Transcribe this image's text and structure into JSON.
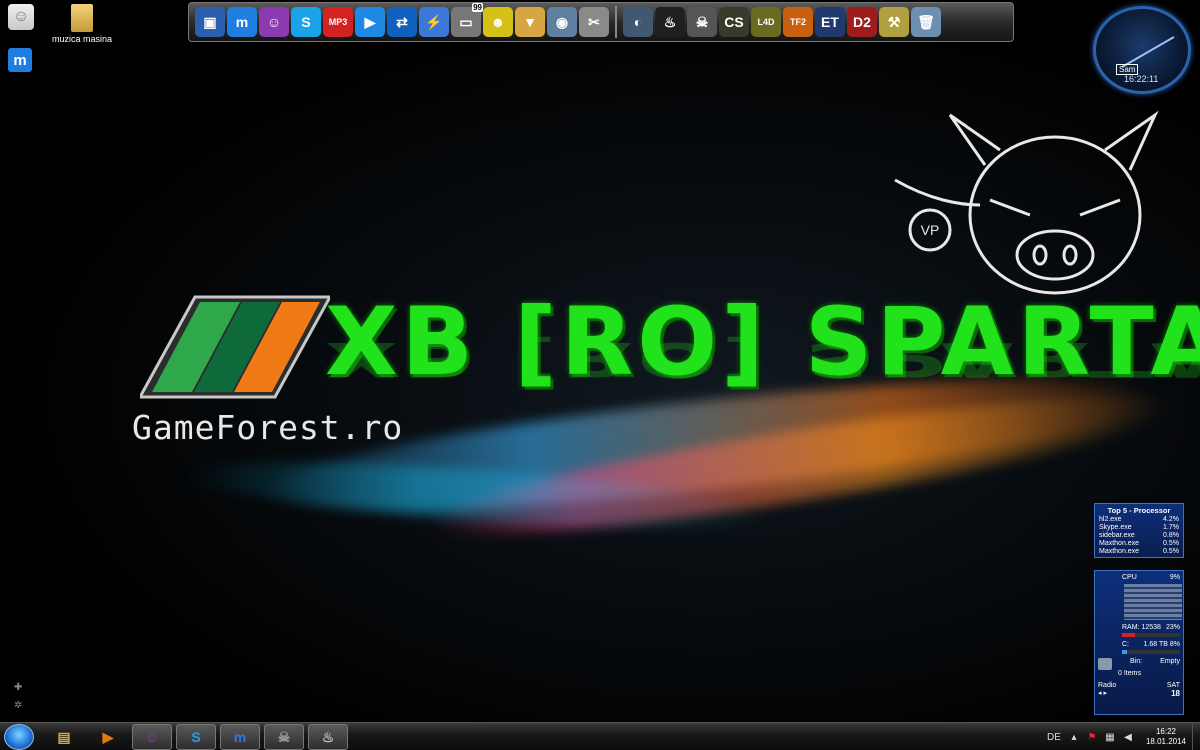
{
  "desktop": {
    "icons": [
      {
        "label": ""
      },
      {
        "label": "muzica masina"
      },
      {
        "label": ""
      }
    ]
  },
  "wallpaper": {
    "headline": "XB [RO] SPARTA",
    "site": "GameForest.ro",
    "pig_badge": "VP"
  },
  "dock": {
    "badge_count": "99",
    "apps": [
      {
        "icon": "computer-icon",
        "glyph": "▣",
        "color": "#2a5fb0"
      },
      {
        "icon": "maxthon-icon",
        "glyph": "m",
        "color": "#1f7ee0"
      },
      {
        "icon": "messenger-icon",
        "glyph": "☺",
        "color": "#8d3ab0"
      },
      {
        "icon": "skype-icon",
        "glyph": "S",
        "color": "#1aa3e8"
      },
      {
        "icon": "mp3-icon",
        "glyph": "MP3",
        "color": "#d32222"
      },
      {
        "icon": "media-player-icon",
        "glyph": "▶",
        "color": "#1e88e5"
      },
      {
        "icon": "teamviewer-icon",
        "glyph": "⇄",
        "color": "#1060c0"
      },
      {
        "icon": "daemon-tools-icon",
        "glyph": "⚡",
        "color": "#3c78d8"
      },
      {
        "icon": "monitor-icon",
        "glyph": "▭",
        "color": "#777"
      },
      {
        "icon": "smiley-icon",
        "glyph": "☻",
        "color": "#d5c018"
      },
      {
        "icon": "downloads-folder-icon",
        "glyph": "▼",
        "color": "#d8a640"
      },
      {
        "icon": "network-icon",
        "glyph": "◉",
        "color": "#5d7fa0"
      },
      {
        "icon": "tools-icon",
        "glyph": "✂",
        "color": "#8a8a8a"
      }
    ],
    "games": [
      {
        "icon": "dota-icon",
        "glyph": "◐",
        "color": "#405870"
      },
      {
        "icon": "steam-icon",
        "glyph": "♨",
        "color": "#202020"
      },
      {
        "icon": "counter-strike-icon",
        "glyph": "☠",
        "color": "#555"
      },
      {
        "icon": "csgo-icon",
        "glyph": "CS",
        "color": "#3a3a2a"
      },
      {
        "icon": "left4dead2-icon",
        "glyph": "L4D",
        "color": "#6a6a20"
      },
      {
        "icon": "team-fortress-icon",
        "glyph": "TF2",
        "color": "#c86010"
      },
      {
        "icon": "euro-truck-icon",
        "glyph": "ET",
        "color": "#203a70"
      },
      {
        "icon": "dota2-icon",
        "glyph": "D2",
        "color": "#a01c1c"
      },
      {
        "icon": "pickaxe-icon",
        "glyph": "⚒",
        "color": "#b0a040"
      },
      {
        "icon": "recycle-bin-icon",
        "glyph": "🗑",
        "color": "#6f8fb0"
      }
    ]
  },
  "clock_gadget": {
    "name": "Sam",
    "time": "16:22:11"
  },
  "top_processes": {
    "title": "Top 5 - Processor",
    "rows": [
      {
        "name": "hl2.exe",
        "value": "4.2%"
      },
      {
        "name": "Skype.exe",
        "value": "1.7%"
      },
      {
        "name": "sidebar.exe",
        "value": "0.8%"
      },
      {
        "name": "Maxthon.exe",
        "value": "0.5%"
      },
      {
        "name": "Maxthon.exe",
        "value": "0.5%"
      }
    ]
  },
  "system_gadget": {
    "cpu_label": "CPU",
    "cpu_value": "9%",
    "ram_label": "RAM: 12538",
    "ram_value": "23%",
    "ram_fraction": 0.23,
    "disk_label": "C:",
    "disk_value": "1.68 TB 8%",
    "disk_fraction": 0.08,
    "bin_label": "Bin:",
    "bin_items": "0 Items",
    "bin_state": "Empty",
    "radio_label": "Radio",
    "day": "SAT",
    "date": "18"
  },
  "taskbar": {
    "buttons": [
      {
        "name": "explorer-icon",
        "glyph": "▤",
        "color": "#d8a640"
      },
      {
        "name": "media-player-icon",
        "glyph": "▶",
        "color": "#e07a10"
      },
      {
        "name": "messenger-icon",
        "glyph": "☺",
        "color": "#8d3ab0"
      },
      {
        "name": "skype-icon",
        "glyph": "S",
        "color": "#1aa3e8"
      },
      {
        "name": "maxthon-icon",
        "glyph": "m",
        "color": "#1f7ee0"
      },
      {
        "name": "counter-strike-icon",
        "glyph": "☠",
        "color": "#999"
      },
      {
        "name": "steam-icon",
        "glyph": "♨",
        "color": "#bbb"
      }
    ],
    "language": "DE",
    "time": "16:22",
    "date": "18.01.2014"
  }
}
